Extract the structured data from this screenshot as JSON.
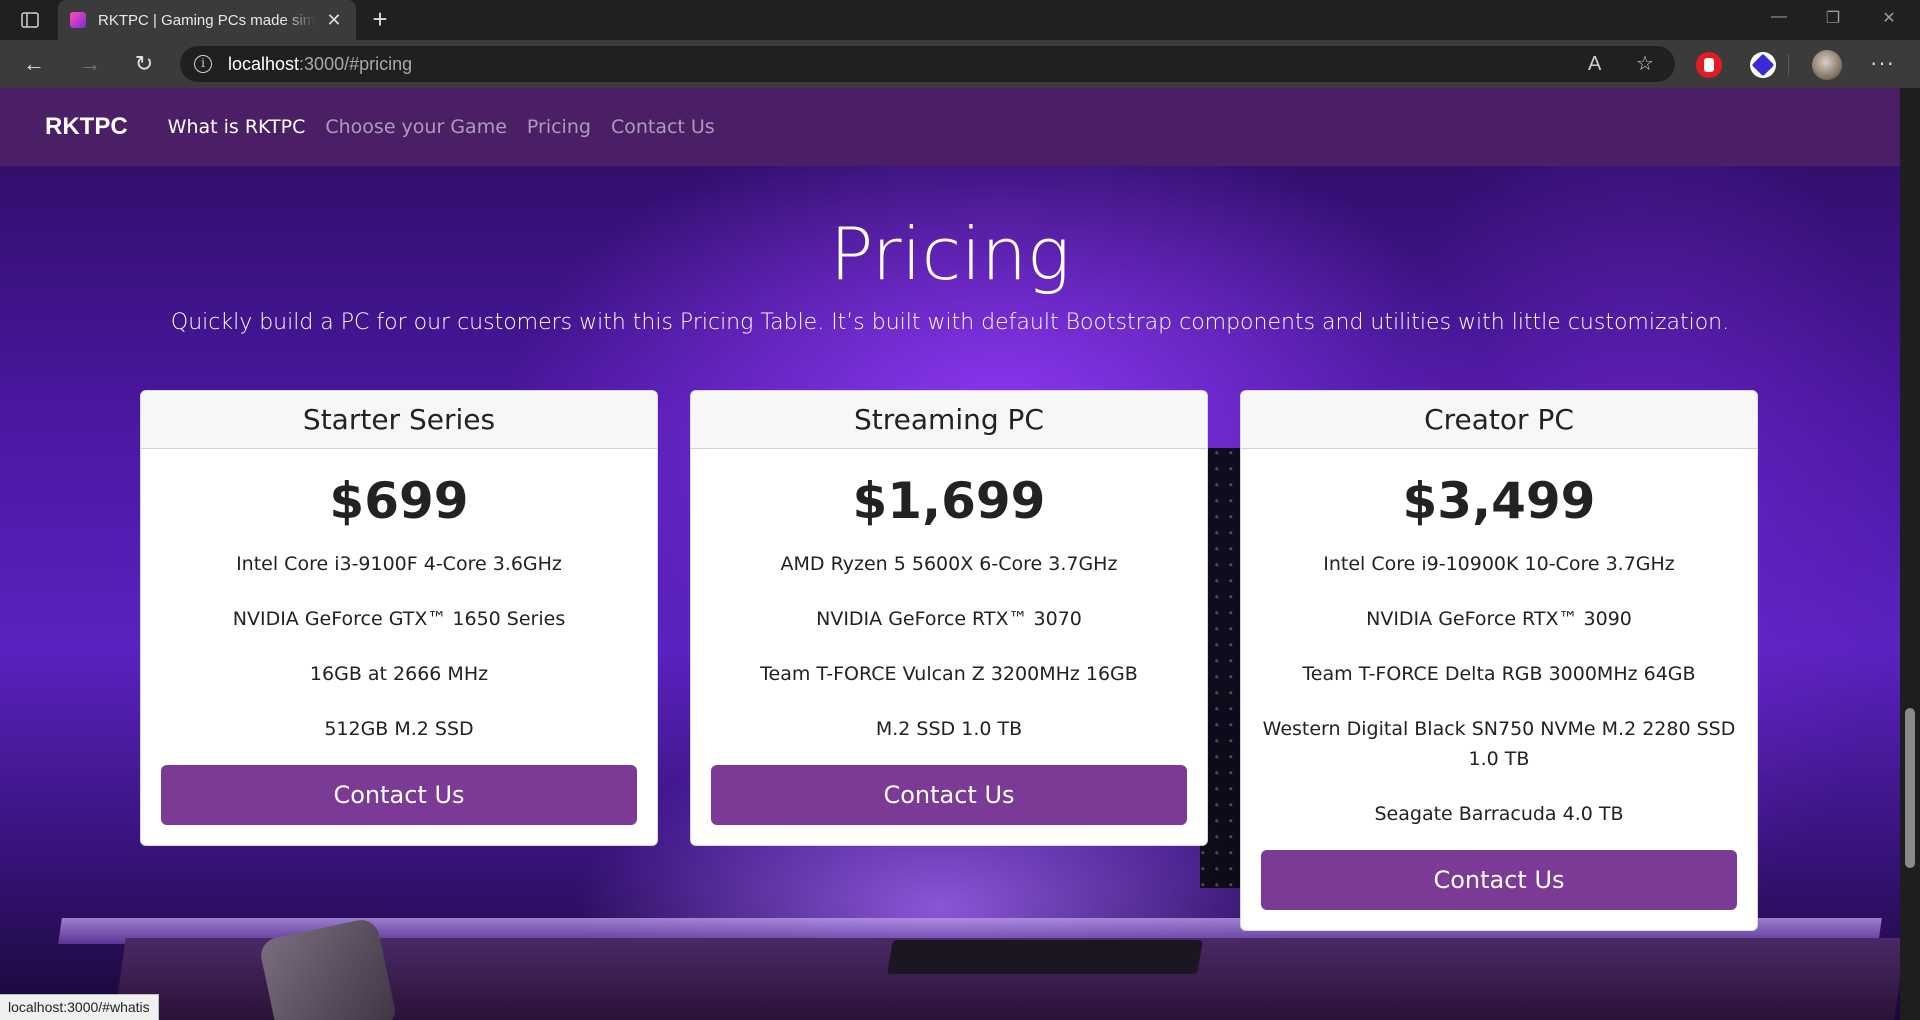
{
  "browser": {
    "tab_title": "RKTPC | Gaming PCs made simple",
    "url_host": "localhost",
    "url_rest": ":3000/#pricing",
    "status_url": "localhost:3000/#whatis"
  },
  "site": {
    "brand": "RKTPC",
    "nav": [
      {
        "label": "What is RKTPC"
      },
      {
        "label": "Choose your Game"
      },
      {
        "label": "Pricing"
      },
      {
        "label": "Contact Us"
      }
    ]
  },
  "pricing": {
    "title": "Pricing",
    "lead": "Quickly build a PC for our customers with this Pricing Table. It’s built with default Bootstrap components and utilities with little customization.",
    "plans": [
      {
        "name": "Starter Series",
        "price": "$699",
        "features": [
          "Intel Core i3-9100F 4-Core 3.6GHz",
          "NVIDIA GeForce GTX™ 1650 Series",
          "16GB at 2666 MHz",
          "512GB M.2 SSD"
        ],
        "cta": "Contact Us"
      },
      {
        "name": "Streaming PC",
        "price": "$1,699",
        "features": [
          "AMD Ryzen 5 5600X 6-Core 3.7GHz",
          "NVIDIA GeForce RTX™ 3070",
          "Team T-FORCE Vulcan Z 3200MHz 16GB",
          "M.2 SSD 1.0 TB"
        ],
        "cta": "Contact Us"
      },
      {
        "name": "Creator PC",
        "price": "$3,499",
        "features": [
          "Intel Core i9-10900K 10-Core 3.7GHz",
          "NVIDIA GeForce RTX™ 3090",
          "Team T-FORCE Delta RGB 3000MHz 64GB",
          "Western Digital Black SN750 NVMe M.2 2280 SSD 1.0 TB",
          "Seagate Barracuda 4.0 TB"
        ],
        "cta": "Contact Us"
      }
    ]
  },
  "colors": {
    "navbar": "#4a1f66",
    "button": "#7b3a96",
    "background_accent": "#5a22c0"
  }
}
